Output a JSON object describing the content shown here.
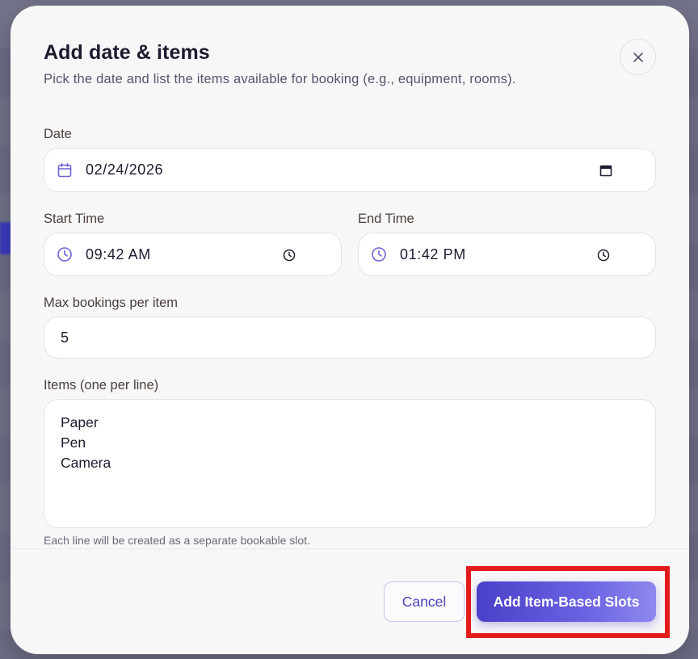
{
  "dialog": {
    "title": "Add date & items",
    "subtitle": "Pick the date and list the items available for booking (e.g., equipment, rooms).",
    "close_icon": "close-icon"
  },
  "date": {
    "label": "Date",
    "value": "02/24/2026",
    "icon": "calendar-icon",
    "picker_icon": "calendar-picker-icon"
  },
  "start_time": {
    "label": "Start Time",
    "value": "09:42 AM",
    "icon": "clock-icon",
    "picker_icon": "clock-picker-icon"
  },
  "end_time": {
    "label": "End Time",
    "value": "01:42 PM",
    "icon": "clock-icon",
    "picker_icon": "clock-picker-icon"
  },
  "max_bookings": {
    "label": "Max bookings per item",
    "value": "5"
  },
  "items": {
    "label": "Items (one per line)",
    "lines": [
      "Paper",
      "Pen",
      "Camera"
    ],
    "hint": "Each line will be created as a separate bookable slot."
  },
  "actions": {
    "cancel_label": "Cancel",
    "submit_label": "Add Item-Based Slots"
  },
  "colors": {
    "accent": "#5a52d6",
    "highlight": "#e31b1b",
    "icon_accent": "#6b63d8"
  }
}
